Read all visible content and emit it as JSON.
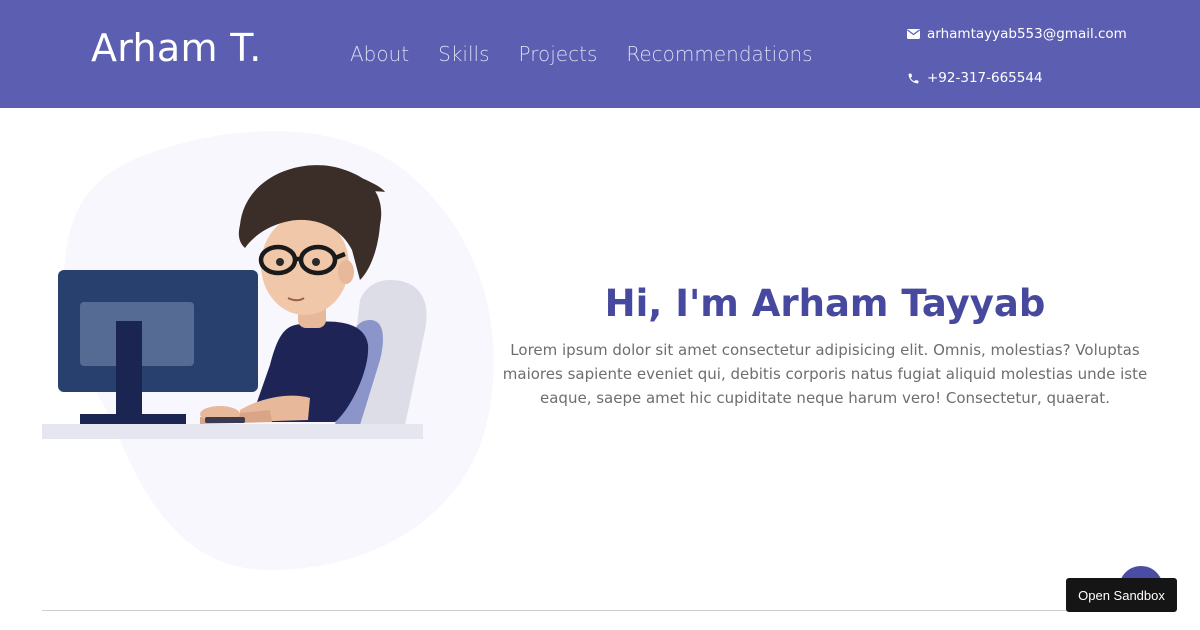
{
  "header": {
    "brand": "Arham T.",
    "nav": [
      {
        "label": "About"
      },
      {
        "label": "Skills"
      },
      {
        "label": "Projects"
      },
      {
        "label": "Recommendations"
      }
    ],
    "email": {
      "icon": "envelope-icon",
      "text": "arhamtayyab553@gmail.com"
    },
    "phone": {
      "icon": "phone-icon",
      "text": "+92-317-665544"
    }
  },
  "hero": {
    "title": "Hi, I'm Arham Tayyab",
    "text": "Lorem ipsum dolor sit amet consectetur adipisicing elit. Omnis, molestias? Voluptas maiores sapiente eveniet qui, debitis corporis natus fugiat aliquid molestias unde iste eaque, saepe amet hic cupiditate neque harum vero! Consectetur, quaerat.",
    "illustration": "developer-at-computer-illustration"
  },
  "scroll_top": {
    "icon": "chevron-up-icon"
  },
  "sandbox_button": {
    "label": "Open Sandbox"
  },
  "colors": {
    "header_bg": "#5c5fb1",
    "title": "#47499e",
    "body_text": "#6e6e6e",
    "blob": "#f7f7fd"
  }
}
